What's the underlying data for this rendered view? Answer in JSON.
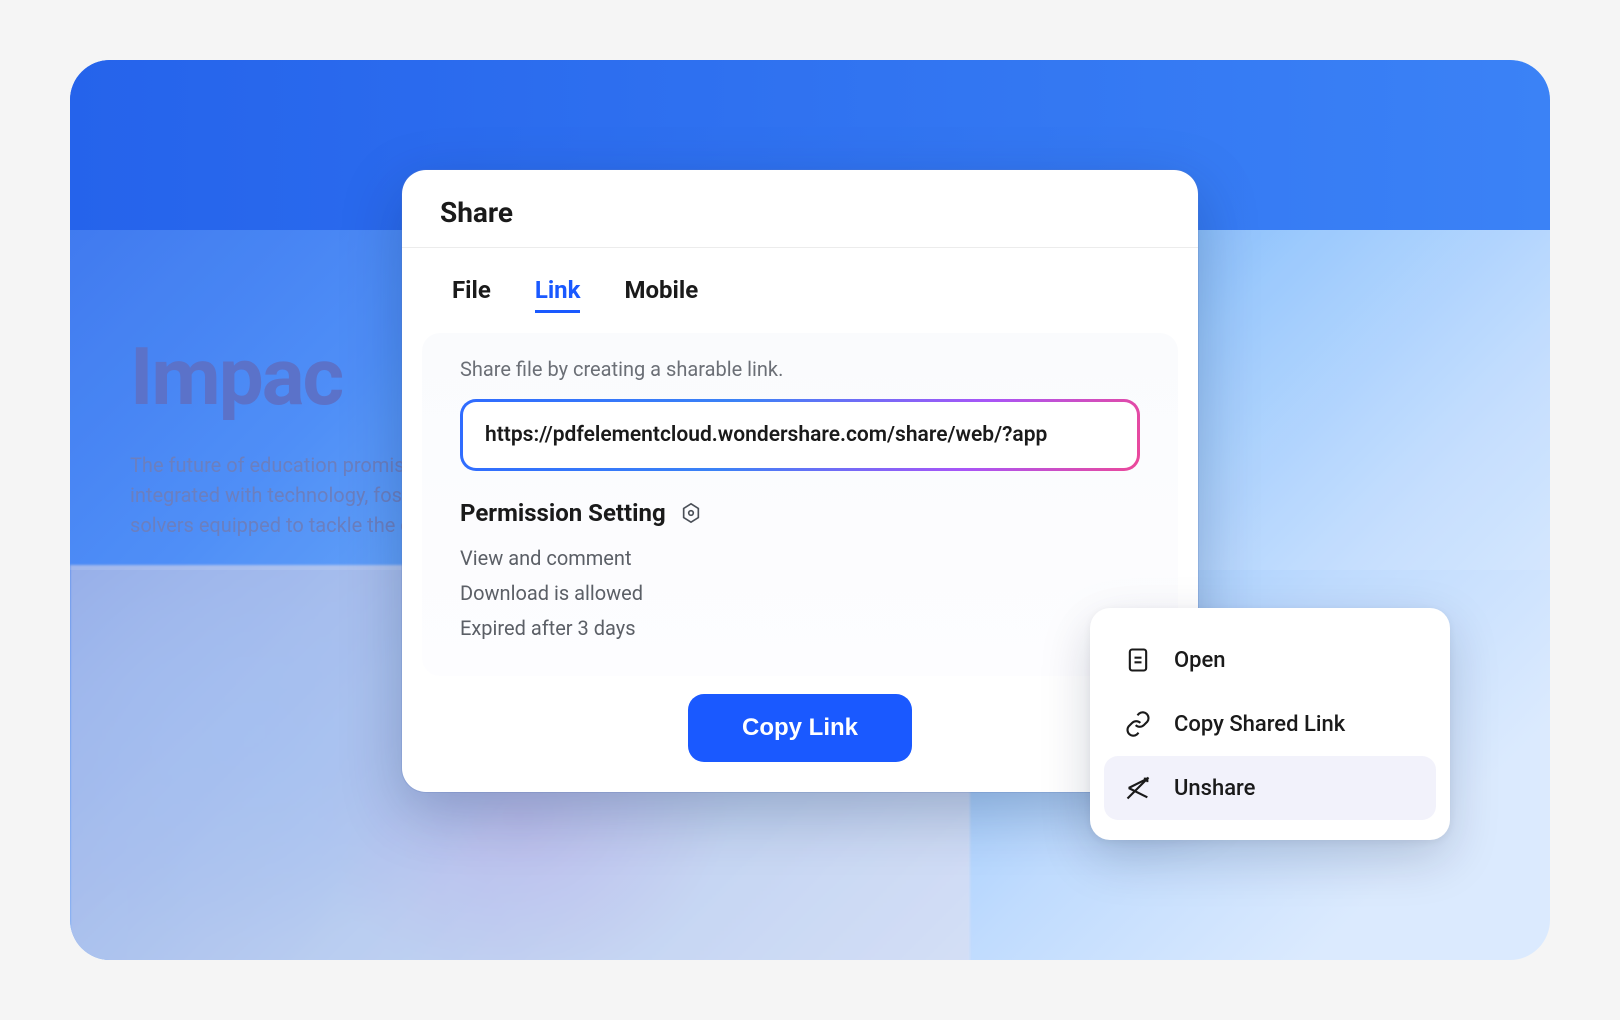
{
  "background": {
    "doc_title": "Impac",
    "doc_body_line1": "The future of education promise",
    "doc_body_line2": "integrated with technology, fost",
    "doc_body_line3": "solvers equipped to tackle the c"
  },
  "dialog": {
    "title": "Share",
    "tabs": {
      "file": "File",
      "link": "Link",
      "mobile": "Mobile"
    },
    "active_tab": "link",
    "hint": "Share file by creating a sharable link.",
    "link_url": "https://pdfelementcloud.wondershare.com/share/web/?app",
    "permission": {
      "heading": "Permission Setting",
      "lines": {
        "0": "View and comment",
        "1": "Download is allowed",
        "2": "Expired after 3 days"
      }
    },
    "copy_button": "Copy Link"
  },
  "context_menu": {
    "items": {
      "0": {
        "label": "Open"
      },
      "1": {
        "label": "Copy Shared Link"
      },
      "2": {
        "label": "Unshare"
      }
    },
    "hover_index": 2
  }
}
